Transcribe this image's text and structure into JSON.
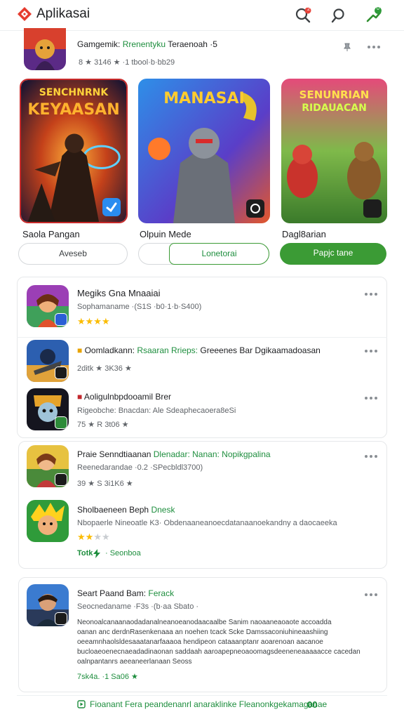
{
  "header": {
    "title": "Aplikasai",
    "icons": [
      "logo-diamond",
      "search-icon",
      "search-icon",
      "trend-arrow-icon"
    ],
    "badges": [
      "2",
      "0"
    ]
  },
  "top_row": {
    "title_plain": "Gamgemik:",
    "title_green": "Rrenentyku",
    "title_tail": "Teraenoah  ·5",
    "meta": "8  ★ 3146  ★  ·1 tbool·b·bb29"
  },
  "featured": [
    {
      "art_title_1": "SENCHNRNK",
      "art_title_2": "KEYAASAN",
      "label": "Saola Pangan"
    },
    {
      "art_title_1": "MANASAI",
      "art_title_2": "",
      "label": "Olpuin Mede"
    },
    {
      "art_title_1": "SENUNRIAN",
      "art_title_2": "RIDAUACAN",
      "label": "Dagl8arian"
    }
  ],
  "buttons": [
    "Aveseb",
    "Lonetorai",
    "Papjc tane"
  ],
  "list": [
    {
      "title": "Megiks Gna Mnaaiai",
      "meta": "Sophamaname  ·(S1S ·b0·1·b·S400)",
      "rating": 4,
      "stars_text": "★★★★"
    },
    {
      "title_plain": "Oomladkann:",
      "title_green": "Rsaaran  Rrieps:",
      "title_tail": "Greeenes  Bar  Dgikaamadoasan",
      "meta": "2ditk  ★ 3K36  ★"
    },
    {
      "title": "Aoligulnbpdooamil Brer",
      "meta_1": "Rigeobche:  Bnacdan: Ale  Sdeaphecaoera8eSi",
      "meta_2": "75  ★  R 3t06  ★"
    },
    {
      "title_plain": "Praie  Senndtiaanan",
      "title_green": "Dlenadar:  Nanan:  Nopikgpalina",
      "meta_1": "Reenedarandae  ·0.2  ·SPecbldl3700)",
      "meta_2": "39  ★  S 3i1K6  ★"
    },
    {
      "title_plain": "Sholbaeneen  Beph",
      "title_green": "Dnesk",
      "meta": "Nbopaerle  Nineoatle  K3·  Obdenaaneanoecdatanaanoekandny a daocaeeka",
      "rating": 2.5,
      "stars_text": "★★★★",
      "tag_1": "Totk",
      "tag_2": "· Seonboa"
    },
    {
      "title_plain": "Seart  Paand Bam:",
      "title_green": "Ferack",
      "meta": "Seocnedaname  ·F3s ·(b·aa Sbato ·",
      "desc": [
        "Neonoalcanaanaodadanalneanoeanodaacaalbe  Sanim  naoaaneaoaote  accoadda",
        "oanan anc  derdnRasenkenaaa an  noehen tcack  Scke  Damssaconiuhineaashiing",
        "oeeamnhaolsldesaaatanarfaaaoa  hendipeon  cataaanptanr  aoarenoan  aacanoe",
        "bucloaeoenecnaeadadinaonan  saddaah  aaroapepneoaoomagsdeeneneaaaaacce  cacedan",
        "oalnpantanrs  aeeaneerlanaan  Seoss"
      ],
      "meta_2": "7sk4a.  ·1  Sa06  ★"
    }
  ],
  "footer": {
    "text": "Fioanant  Fera  peandenanrl  anaraklinke  Fleanonkgekamaganae",
    "badge": "00"
  },
  "colors": {
    "accent_green": "#3b9b35",
    "text_green": "#1e8e3e",
    "star": "#fbbc04",
    "logo_red": "#e63b2e"
  }
}
